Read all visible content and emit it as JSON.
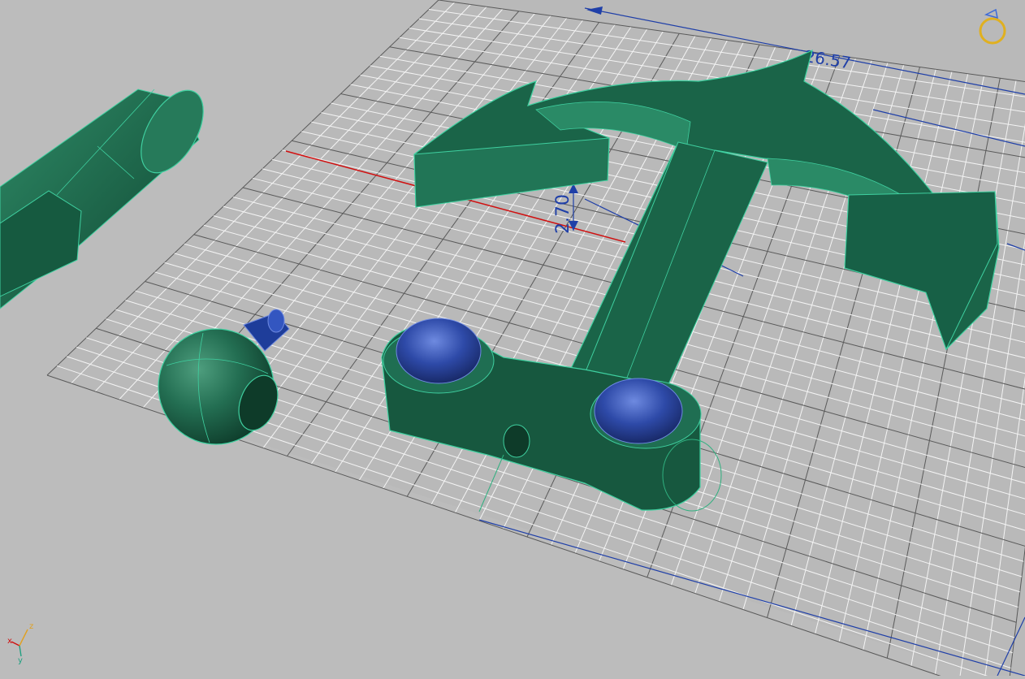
{
  "viewport": {
    "background": "#bcbcbc",
    "grid_color": "#f4f4f4",
    "model_color": "#1e6a4e",
    "model_edge_color": "#3fd0a0",
    "accent_blue": "#2a4aa8",
    "dimension_color": "#1f3fa8",
    "axis_red": "#d01010"
  },
  "dimensions": {
    "top_value": "26.57",
    "thickness_value": "2.70"
  },
  "triad": {
    "x_label": "x",
    "y_label": "y",
    "z_label": "z"
  },
  "nav": {
    "orbit_icon": "orbit-icon"
  }
}
